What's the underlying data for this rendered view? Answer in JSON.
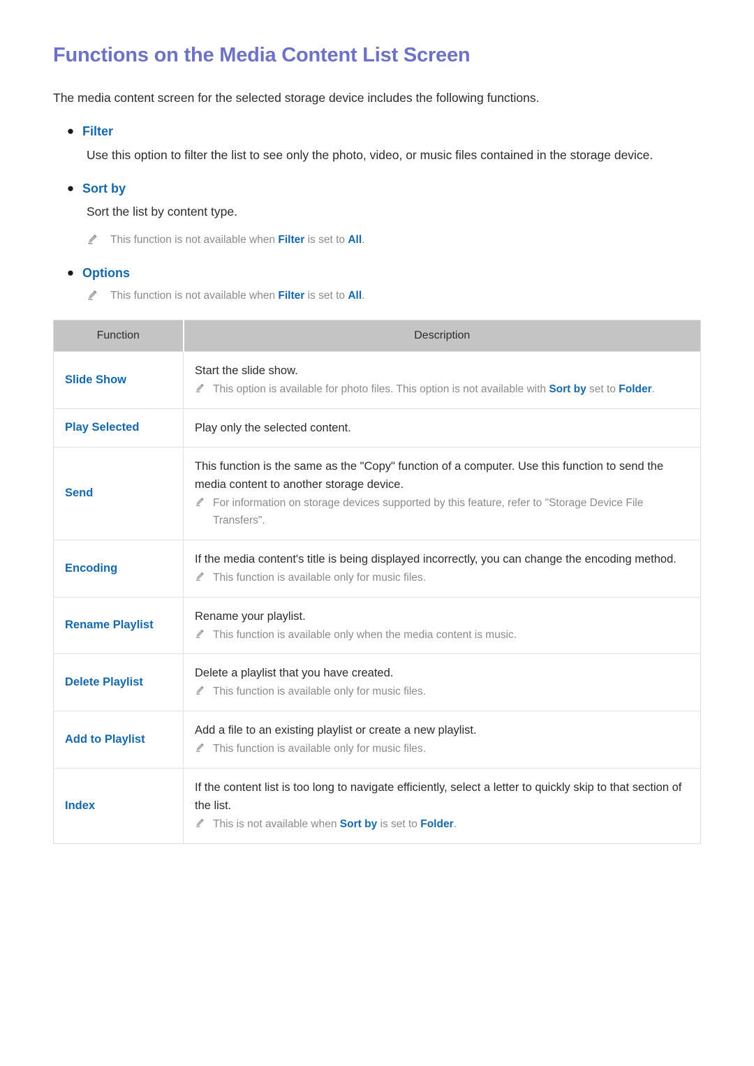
{
  "page": {
    "title": "Functions on the Media Content List Screen",
    "intro": "The media content screen for the selected storage device includes the following functions."
  },
  "colors": {
    "title": "#6e72c4",
    "link": "#1668ad",
    "note_text": "#8b8b8b",
    "body_text": "#2b2b2b",
    "table_header_bg": "#c4c4c4",
    "table_border": "#e2e2e2"
  },
  "bullet_glyph": "●",
  "sections": [
    {
      "label": "Filter",
      "body": "Use this option to filter the list to see only the photo, video, or music files contained in the storage device.",
      "note": null
    },
    {
      "label": "Sort by",
      "body": "Sort the list by content type.",
      "note": {
        "icon": "pencil-icon",
        "parts": [
          {
            "text": "This function is not available when ",
            "bold": false
          },
          {
            "text": "Filter",
            "bold": true
          },
          {
            "text": " is set to ",
            "bold": false
          },
          {
            "text": "All",
            "bold": true
          },
          {
            "text": ".",
            "bold": false
          }
        ]
      }
    },
    {
      "label": "Options",
      "body": null,
      "note": {
        "icon": "pencil-icon",
        "parts": [
          {
            "text": "This function is not available when ",
            "bold": false
          },
          {
            "text": "Filter",
            "bold": true
          },
          {
            "text": " is set to ",
            "bold": false
          },
          {
            "text": "All",
            "bold": true
          },
          {
            "text": ".",
            "bold": false
          }
        ]
      }
    }
  ],
  "table": {
    "headers": [
      "Function",
      "Description"
    ],
    "rows": [
      {
        "function": "Slide Show",
        "description": "Start the slide show.",
        "note": {
          "icon": "pencil-icon",
          "parts": [
            {
              "text": "This option is available for photo files. This option is not available with ",
              "bold": false
            },
            {
              "text": "Sort by",
              "bold": true
            },
            {
              "text": " set to ",
              "bold": false
            },
            {
              "text": "Folder",
              "bold": true
            },
            {
              "text": ".",
              "bold": false
            }
          ]
        }
      },
      {
        "function": "Play Selected",
        "description": "Play only the selected content.",
        "note": null
      },
      {
        "function": "Send",
        "description": "This function is the same as the \"Copy\" function of a computer. Use this function to send the media content to another storage device.",
        "note": {
          "icon": "pencil-icon",
          "parts": [
            {
              "text": "For information on storage devices supported by this feature, refer to \"Storage Device File Transfers\".",
              "bold": false
            }
          ]
        }
      },
      {
        "function": "Encoding",
        "description": "If the media content's title is being displayed incorrectly, you can change the encoding method.",
        "note": {
          "icon": "pencil-icon",
          "parts": [
            {
              "text": "This function is available only for music files.",
              "bold": false
            }
          ]
        }
      },
      {
        "function": "Rename Playlist",
        "description": "Rename your playlist.",
        "note": {
          "icon": "pencil-icon",
          "parts": [
            {
              "text": "This function is available only when the media content is music.",
              "bold": false
            }
          ]
        }
      },
      {
        "function": "Delete Playlist",
        "description": "Delete a playlist that you have created.",
        "note": {
          "icon": "pencil-icon",
          "parts": [
            {
              "text": "This function is available only for music files.",
              "bold": false
            }
          ]
        }
      },
      {
        "function": "Add to Playlist",
        "description": "Add a file to an existing playlist or create a new playlist.",
        "note": {
          "icon": "pencil-icon",
          "parts": [
            {
              "text": "This function is available only for music files.",
              "bold": false
            }
          ]
        }
      },
      {
        "function": "Index",
        "description": "If the content list is too long to navigate efficiently, select a letter to quickly skip to that section of the list.",
        "note": {
          "icon": "pencil-icon",
          "parts": [
            {
              "text": "This is not available when ",
              "bold": false
            },
            {
              "text": "Sort by",
              "bold": true
            },
            {
              "text": " is set to ",
              "bold": false
            },
            {
              "text": "Folder",
              "bold": true
            },
            {
              "text": ".",
              "bold": false
            }
          ]
        }
      }
    ]
  }
}
